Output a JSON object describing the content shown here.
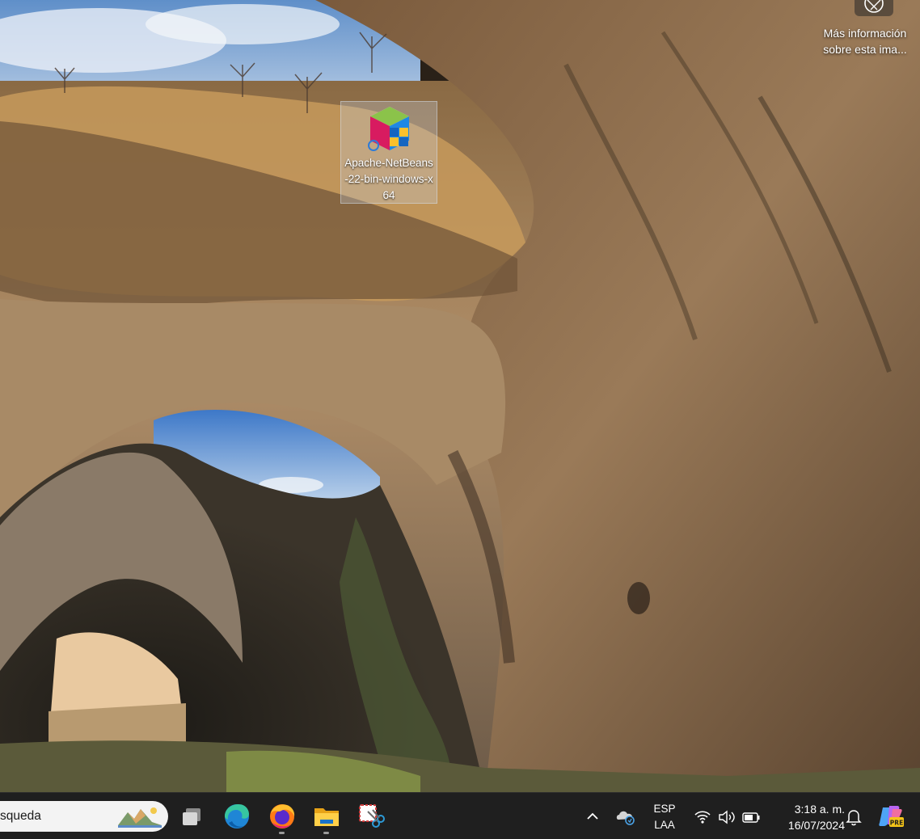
{
  "desktop": {
    "icons": [
      {
        "label": "Apache-NetBeans-22-bin-windows-x64",
        "icon": "netbeans-installer-icon"
      }
    ],
    "spotlight": {
      "label": "Más información sobre esta ima...",
      "icon": "camera-lens-icon"
    }
  },
  "taskbar": {
    "search": {
      "text": "squeda",
      "icon": "search-highlight-illustration"
    },
    "apps": [
      {
        "name": "task-view",
        "icon": "task-view-icon"
      },
      {
        "name": "edge",
        "icon": "edge-icon"
      },
      {
        "name": "firefox",
        "icon": "firefox-icon",
        "running": true
      },
      {
        "name": "file-explorer",
        "icon": "folder-icon",
        "running": true
      },
      {
        "name": "snipping-tool",
        "icon": "snipping-tool-icon"
      }
    ],
    "tray": {
      "chevron_icon": "chevron-up-icon",
      "onedrive_icon": "onedrive-icon",
      "language_line1": "ESP",
      "language_line2": "LAA",
      "network_icon": "wifi-icon",
      "volume_icon": "volume-icon",
      "battery_icon": "battery-icon",
      "time": "3:18 a. m.",
      "date": "16/07/2024",
      "notifications_icon": "bell-icon",
      "copilot_icon": "copilot-icon",
      "copilot_badge": "PRE"
    }
  },
  "colors": {
    "taskbar_bg": "#1f1f1f",
    "search_bg": "#f3f3f3"
  }
}
